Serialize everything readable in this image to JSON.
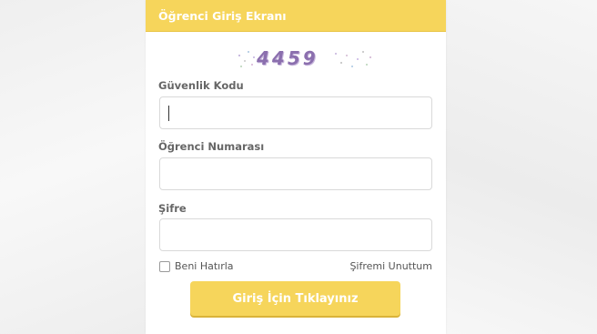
{
  "login_panel": {
    "title": "Öğrenci Giriş Ekranı",
    "captcha": {
      "code": "4459"
    },
    "security_code": {
      "label": "Güvenlik Kodu",
      "value": "",
      "placeholder": ""
    },
    "student_number": {
      "label": "Öğrenci Numarası",
      "value": "",
      "placeholder": ""
    },
    "password": {
      "label": "Şifre",
      "value": "",
      "placeholder": ""
    },
    "remember_me": {
      "label": "Beni Hatırla",
      "checked": false
    },
    "forgot_password": {
      "label": "Şifremi Unuttum"
    },
    "submit": {
      "label": "Giriş İçin Tıklayınız"
    }
  },
  "colors": {
    "accent": "#f6d55b",
    "captcha_text": "#8b6fae",
    "label_text": "#666666",
    "input_border": "#d9d9d9"
  }
}
